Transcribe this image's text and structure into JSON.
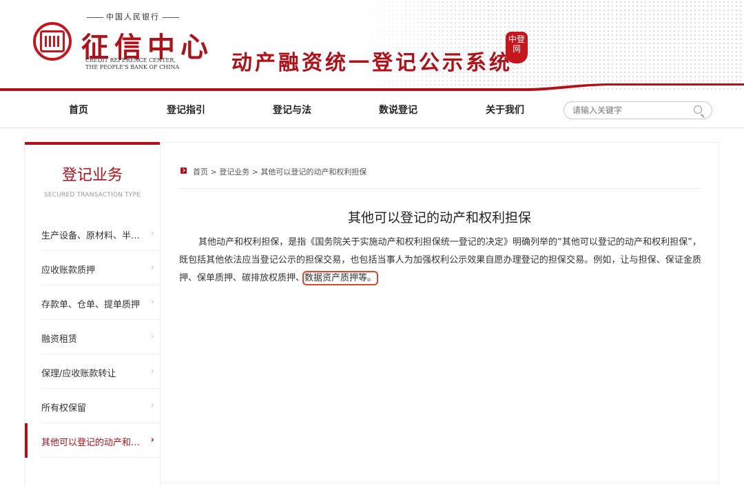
{
  "header": {
    "logo_small": "中国人民银行",
    "logo_big": "征信中心",
    "logo_en_line1": "CREDIT REFERENCE CENTER,",
    "logo_en_line2": "THE PEOPLE'S BANK OF CHINA",
    "system_title": "动产融资统一登记公示系统",
    "seal_text": "中登网"
  },
  "nav": {
    "items": [
      "首页",
      "登记指引",
      "登记与法",
      "数说登记",
      "关于我们"
    ],
    "search_placeholder": "请输入关键字"
  },
  "sidebar": {
    "title": "登记业务",
    "subtitle": "SECURED TRANSACTION TYPE",
    "items": [
      {
        "label": "生产设备、原材料、半成品、产品抵押"
      },
      {
        "label": "应收账款质押"
      },
      {
        "label": "存款单、仓单、提单质押"
      },
      {
        "label": "融资租赁"
      },
      {
        "label": "保理/应收账款转让"
      },
      {
        "label": "所有权保留"
      },
      {
        "label": "其他可以登记的动产和权利担保"
      }
    ],
    "active_index": 6
  },
  "breadcrumb": {
    "home": "首页",
    "sep": " > ",
    "level1": "登记业务",
    "current": "其他可以登记的动产和权利担保"
  },
  "article": {
    "title": "其他可以登记的动产和权利担保",
    "body_main": "其他动产和权利担保，是指《国务院关于实施动产和权利担保统一登记的决定》明确列举的“其他可以登记的动产和权利担保”，既包括其他依法应当登记公示的担保交易，也包括当事人为加强权利公示效果自愿办理登记的担保交易。例如，让与担保、保证金质押、保单质押、碳排放权质押、",
    "body_highlight": "数据资产质押等。"
  },
  "colors": {
    "brand_red": "#b01018",
    "highlight_box": "#d84a2a"
  }
}
